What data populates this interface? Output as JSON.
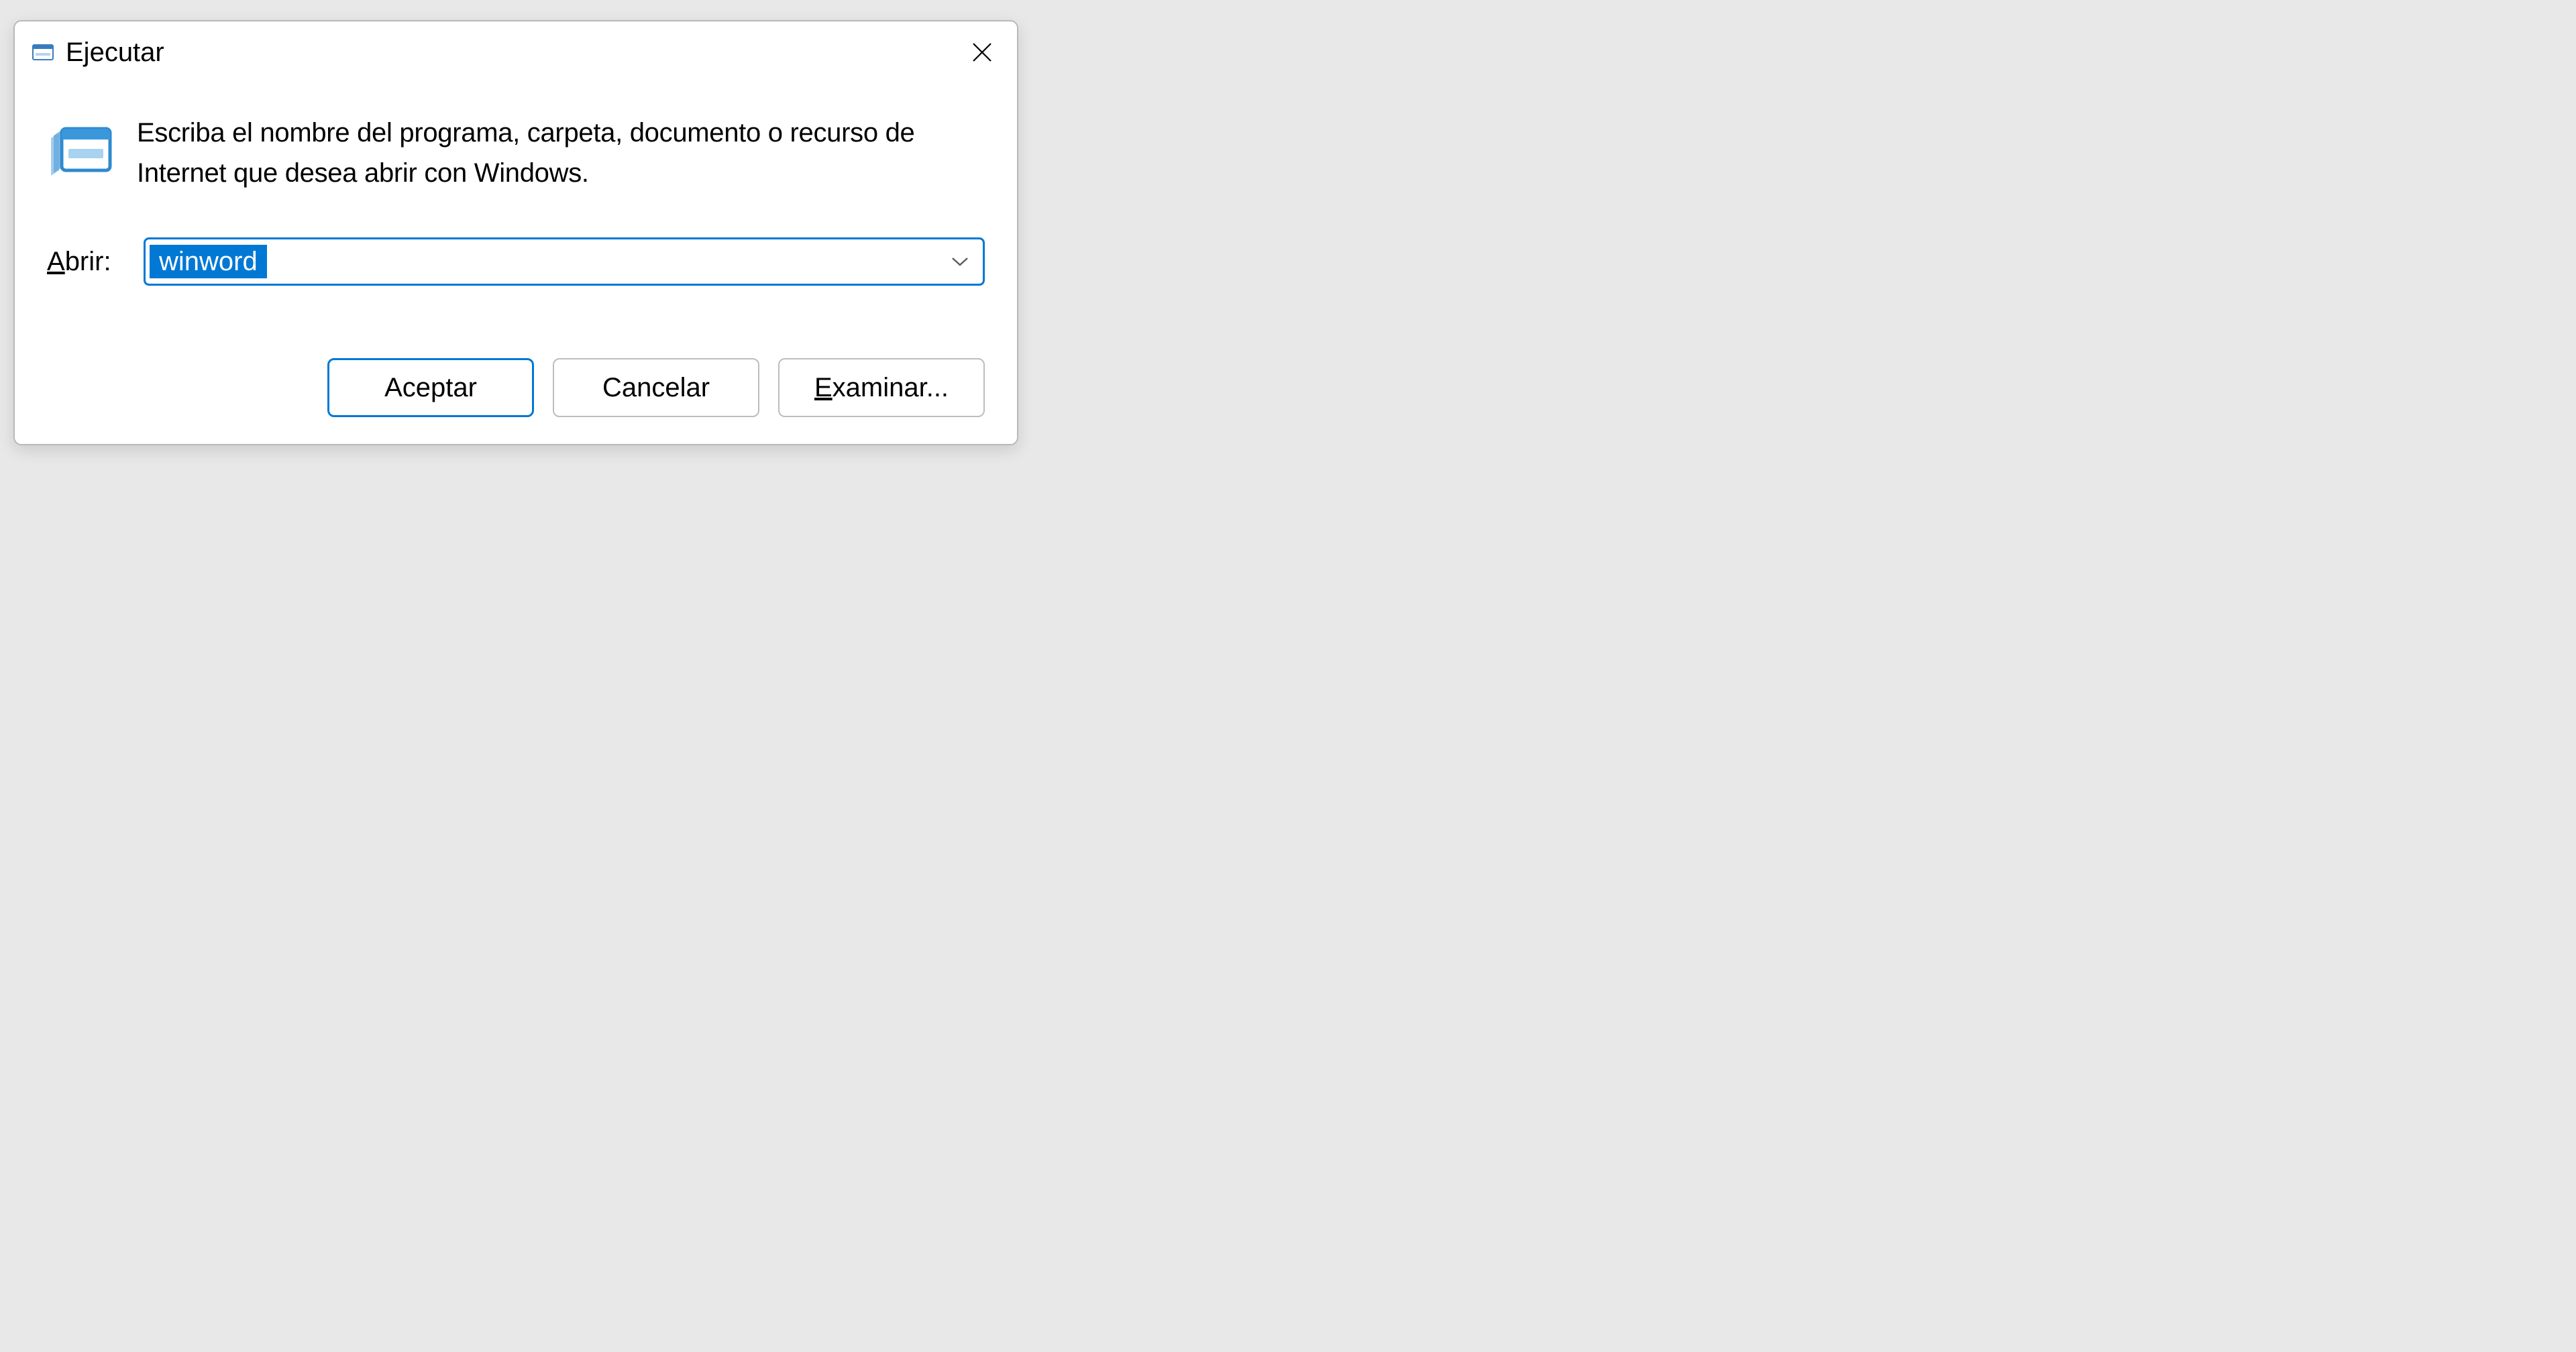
{
  "dialog": {
    "title": "Ejecutar",
    "description": "Escriba el nombre del programa, carpeta, documento o recurso de Internet que desea abrir con Windows.",
    "open_label_prefix": "A",
    "open_label_rest": "brir:",
    "input_value": "winword",
    "buttons": {
      "ok": "Aceptar",
      "cancel": "Cancelar",
      "browse_prefix": "E",
      "browse_rest": "xaminar..."
    }
  }
}
